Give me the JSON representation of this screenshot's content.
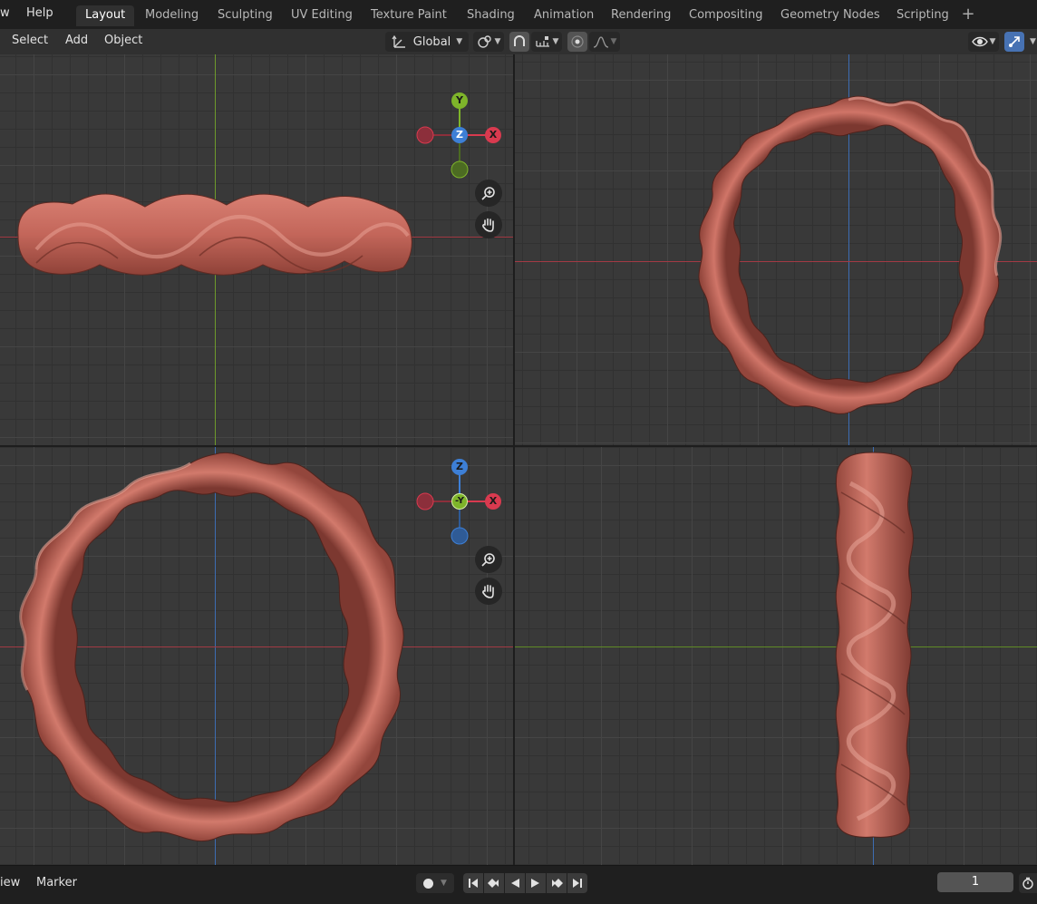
{
  "topbar": {
    "menus": [
      "w",
      "Help"
    ],
    "workspace_tabs": [
      "Layout",
      "Modeling",
      "Sculpting",
      "UV Editing",
      "Texture Paint",
      "Shading",
      "Animation",
      "Rendering",
      "Compositing",
      "Geometry Nodes",
      "Scripting"
    ],
    "active_tab": "Layout",
    "add_workspace_icon": "plus-icon"
  },
  "header": {
    "menus": [
      "Select",
      "Add",
      "Object"
    ],
    "transform_orientation": "Global",
    "icons": [
      "transform-orientation-icon",
      "pivot-point-icon",
      "snap-icon",
      "snap-increment-icon",
      "proportional-editing-icon",
      "falloff-icon",
      "visibility-icon",
      "gizmo-icon"
    ]
  },
  "viewports": {
    "top_left": {
      "gizmo_axes": [
        "Y",
        "Z",
        "X"
      ]
    },
    "bottom_left": {
      "gizmo_axes": [
        "Z",
        "-Y",
        "X"
      ]
    }
  },
  "timeline": {
    "menus": [
      "iew",
      "Marker"
    ],
    "current_frame": "1",
    "icons": [
      "record-icon",
      "jump-start-icon",
      "prev-keyframe-icon",
      "play-reverse-icon",
      "play-icon",
      "next-keyframe-icon",
      "jump-end-icon",
      "stopwatch-icon"
    ]
  },
  "colors": {
    "x_axis": "#d93a4f",
    "y_axis": "#7eb42a",
    "z_axis": "#3d7fd6",
    "object": "#c3665a",
    "active_tab": "#303030"
  }
}
